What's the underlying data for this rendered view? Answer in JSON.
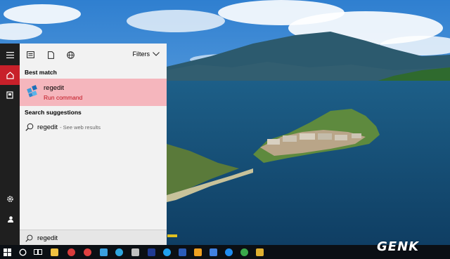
{
  "start_menu": {
    "rail": {
      "items": [
        {
          "name": "hamburger-icon",
          "active": false
        },
        {
          "name": "home-icon",
          "active": true
        },
        {
          "name": "documents-icon",
          "active": false
        },
        {
          "name": "settings-icon",
          "active": false
        },
        {
          "name": "user-icon",
          "active": false
        }
      ]
    },
    "toolbar": {
      "filters_label": "Filters",
      "icons": [
        "apps-filter-icon",
        "documents-filter-icon",
        "web-filter-icon"
      ]
    },
    "best_match": {
      "heading": "Best match",
      "title": "regedit",
      "subtitle": "Run command",
      "icon": "regedit-icon"
    },
    "suggestions": {
      "heading": "Search suggestions",
      "items": [
        {
          "text": "regedit",
          "hint": "- See web results"
        }
      ]
    },
    "search": {
      "value": "regedit"
    }
  },
  "taskbar": {
    "items": [
      {
        "name": "windows-start-icon",
        "color": "#ffffff"
      },
      {
        "name": "cortana-icon",
        "color": "#ffffff"
      },
      {
        "name": "task-view-icon",
        "color": "#ffffff"
      },
      {
        "name": "file-explorer-icon",
        "color": "#f0c040"
      },
      {
        "name": "app-icon-1",
        "color": "#d83b3b"
      },
      {
        "name": "app-icon-2",
        "color": "#e04040"
      },
      {
        "name": "app-icon-3",
        "color": "#3aa0e0"
      },
      {
        "name": "telegram-icon",
        "color": "#2ea6e0"
      },
      {
        "name": "app-icon-4",
        "color": "#c0c0c0"
      },
      {
        "name": "photoshop-icon",
        "color": "#1f3a93"
      },
      {
        "name": "app-icon-5",
        "color": "#e03030"
      },
      {
        "name": "app-icon-6",
        "color": "#ffffff"
      },
      {
        "name": "skype-icon",
        "color": "#1fa0f0"
      },
      {
        "name": "word-icon",
        "color": "#2b5bb8"
      },
      {
        "name": "app-icon-7",
        "color": "#f0a020"
      },
      {
        "name": "app-icon-8",
        "color": "#40a040"
      },
      {
        "name": "app-icon-9",
        "color": "#4080e0"
      },
      {
        "name": "messenger-icon",
        "color": "#1f8cf0"
      },
      {
        "name": "app-icon-10",
        "color": "#4090e0"
      },
      {
        "name": "chrome-icon",
        "color": "#3aa84a"
      },
      {
        "name": "app-icon-11",
        "color": "#e0b030"
      }
    ]
  },
  "watermark": "GENK",
  "colors": {
    "accent": "#c8202a",
    "best_match_bg": "#f5b6bd",
    "subtitle": "#c0101c",
    "panel_bg": "#f2f2f2",
    "rail_bg": "#1f1f1f",
    "taskbar_bg": "#0b0f14"
  }
}
